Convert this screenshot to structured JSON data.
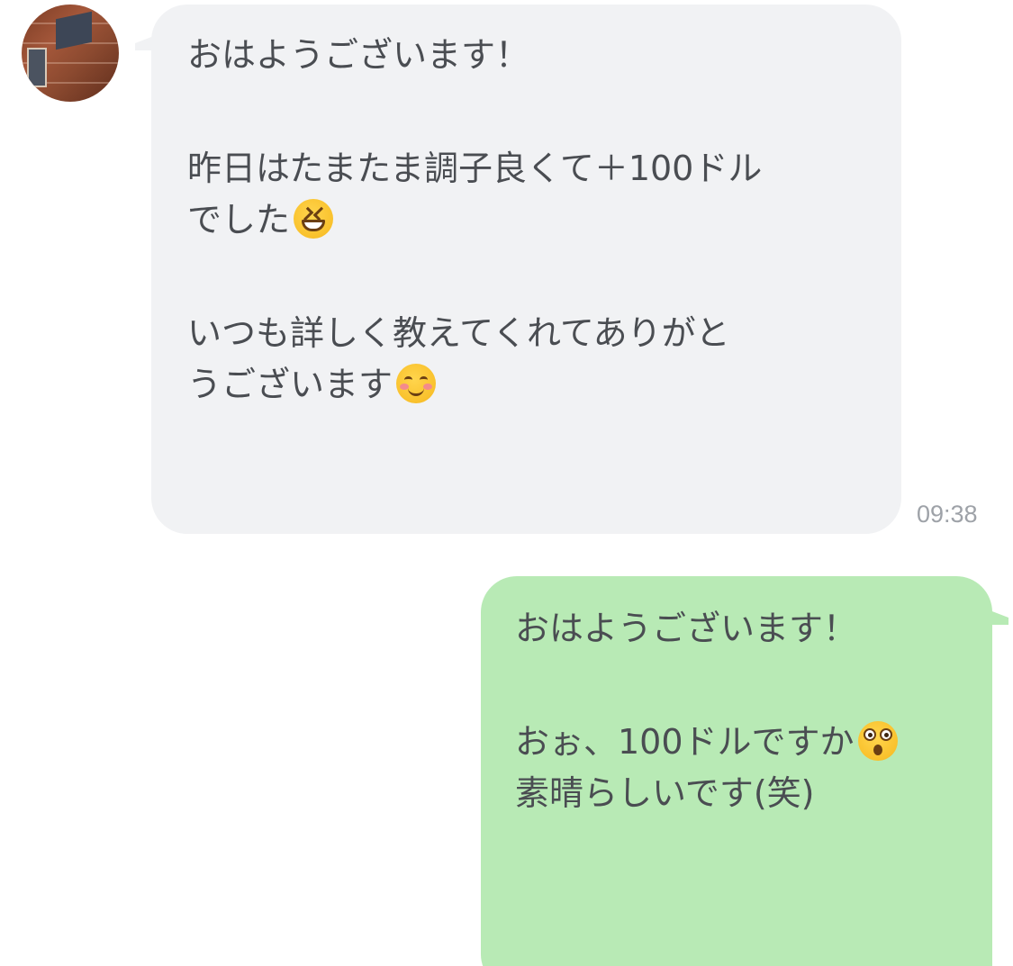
{
  "incoming": {
    "lines": [
      "おはようございます！",
      "",
      "昨日はたまたま調子良くて＋100ドル",
      "でした",
      "",
      "いつも詳しく教えてくれてありがと",
      "うございます"
    ],
    "timestamp": "09:38",
    "emojis": [
      "grinning-squinting-face",
      "smiling-face-with-smiling-eyes"
    ]
  },
  "outgoing": {
    "lines": [
      "おはようございます！",
      "",
      "おぉ、100ドルですか",
      "素晴らしいです(笑)"
    ],
    "emojis": [
      "astonished-face"
    ]
  },
  "colors": {
    "incoming_bubble": "#f1f2f4",
    "outgoing_bubble": "#b8eab5",
    "text": "#4a4d52",
    "timestamp": "#9ea2a8"
  }
}
